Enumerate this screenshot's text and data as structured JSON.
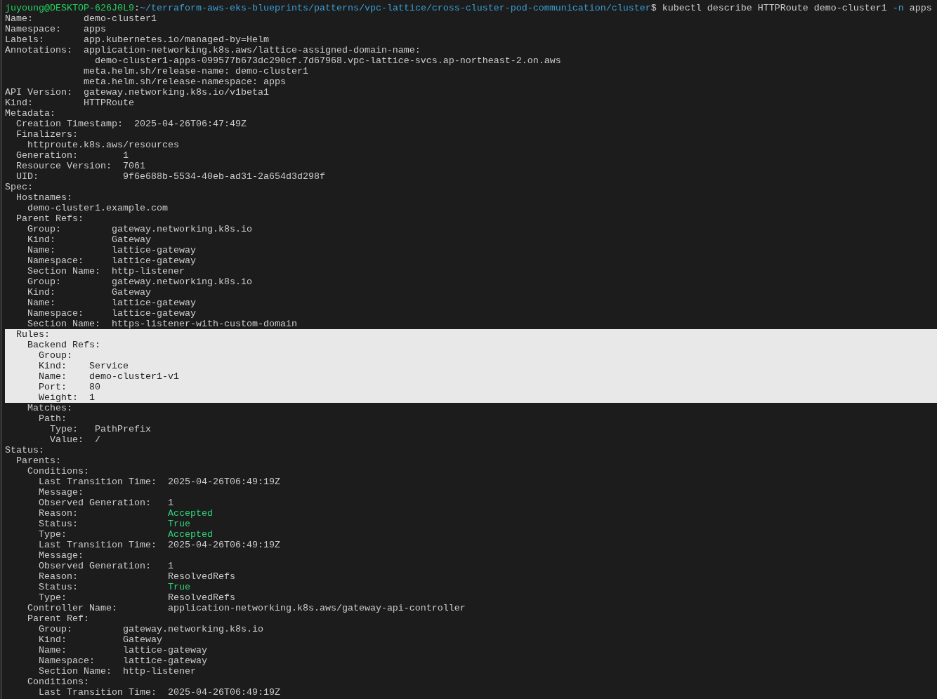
{
  "lines": [
    {
      "selected": false,
      "parts": [
        {
          "text": "juyoung@DESKTOP-626J0L9",
          "kind": "host"
        },
        {
          "text": ":",
          "kind": "plain"
        },
        {
          "text": "~/terraform-aws-eks-blueprints/patterns/vpc-lattice/cross-cluster-pod-communication/cluster",
          "kind": "path"
        },
        {
          "text": "$ kubectl describe HTTPRoute demo-cluster1 ",
          "kind": "plain"
        },
        {
          "text": "-n",
          "kind": "flag"
        },
        {
          "text": " apps",
          "kind": "plain"
        }
      ]
    },
    {
      "selected": false,
      "text": "Name:         demo-cluster1"
    },
    {
      "selected": false,
      "text": "Namespace:    apps"
    },
    {
      "selected": false,
      "text": "Labels:       app.kubernetes.io/managed-by=Helm"
    },
    {
      "selected": false,
      "text": "Annotations:  application-networking.k8s.aws/lattice-assigned-domain-name:"
    },
    {
      "selected": false,
      "text": "                demo-cluster1-apps-099577b673dc290cf.7d67968.vpc-lattice-svcs.ap-northeast-2.on.aws"
    },
    {
      "selected": false,
      "text": "              meta.helm.sh/release-name: demo-cluster1"
    },
    {
      "selected": false,
      "text": "              meta.helm.sh/release-namespace: apps"
    },
    {
      "selected": false,
      "text": "API Version:  gateway.networking.k8s.io/v1beta1"
    },
    {
      "selected": false,
      "text": "Kind:         HTTPRoute"
    },
    {
      "selected": false,
      "text": "Metadata:"
    },
    {
      "selected": false,
      "text": "  Creation Timestamp:  2025-04-26T06:47:49Z"
    },
    {
      "selected": false,
      "text": "  Finalizers:"
    },
    {
      "selected": false,
      "text": "    httproute.k8s.aws/resources"
    },
    {
      "selected": false,
      "text": "  Generation:        1"
    },
    {
      "selected": false,
      "text": "  Resource Version:  7061"
    },
    {
      "selected": false,
      "text": "  UID:               9f6e688b-5534-40eb-ad31-2a654d3d298f"
    },
    {
      "selected": false,
      "text": "Spec:"
    },
    {
      "selected": false,
      "text": "  Hostnames:"
    },
    {
      "selected": false,
      "text": "    demo-cluster1.example.com"
    },
    {
      "selected": false,
      "text": "  Parent Refs:"
    },
    {
      "selected": false,
      "text": "    Group:         gateway.networking.k8s.io"
    },
    {
      "selected": false,
      "text": "    Kind:          Gateway"
    },
    {
      "selected": false,
      "text": "    Name:          lattice-gateway"
    },
    {
      "selected": false,
      "text": "    Namespace:     lattice-gateway"
    },
    {
      "selected": false,
      "text": "    Section Name:  http-listener"
    },
    {
      "selected": false,
      "text": "    Group:         gateway.networking.k8s.io"
    },
    {
      "selected": false,
      "text": "    Kind:          Gateway"
    },
    {
      "selected": false,
      "text": "    Name:          lattice-gateway"
    },
    {
      "selected": false,
      "text": "    Namespace:     lattice-gateway"
    },
    {
      "selected": false,
      "text": "    Section Name:  https-listener-with-custom-domain"
    },
    {
      "selected": true,
      "text": "  Rules:"
    },
    {
      "selected": true,
      "text": "    Backend Refs:"
    },
    {
      "selected": true,
      "text": "      Group:"
    },
    {
      "selected": true,
      "text": "      Kind:    Service"
    },
    {
      "selected": true,
      "text": "      Name:    demo-cluster1-v1"
    },
    {
      "selected": true,
      "text": "      Port:    80"
    },
    {
      "selected": true,
      "text": "      Weight:  1"
    },
    {
      "selected": false,
      "text": "    Matches:"
    },
    {
      "selected": false,
      "text": "      Path:"
    },
    {
      "selected": false,
      "text": "        Type:   PathPrefix"
    },
    {
      "selected": false,
      "text": "        Value:  /"
    },
    {
      "selected": false,
      "text": "Status:"
    },
    {
      "selected": false,
      "text": "  Parents:"
    },
    {
      "selected": false,
      "text": "    Conditions:"
    },
    {
      "selected": false,
      "text": "      Last Transition Time:  2025-04-26T06:49:19Z"
    },
    {
      "selected": false,
      "text": "      Message:"
    },
    {
      "selected": false,
      "text": "      Observed Generation:   1"
    },
    {
      "selected": false,
      "parts": [
        {
          "text": "      Reason:                ",
          "kind": "plain"
        },
        {
          "text": "Accepted",
          "kind": "ok"
        }
      ]
    },
    {
      "selected": false,
      "parts": [
        {
          "text": "      Status:                ",
          "kind": "plain"
        },
        {
          "text": "True",
          "kind": "ok"
        }
      ]
    },
    {
      "selected": false,
      "parts": [
        {
          "text": "      Type:                  ",
          "kind": "plain"
        },
        {
          "text": "Accepted",
          "kind": "ok"
        }
      ]
    },
    {
      "selected": false,
      "text": "      Last Transition Time:  2025-04-26T06:49:19Z"
    },
    {
      "selected": false,
      "text": "      Message:"
    },
    {
      "selected": false,
      "text": "      Observed Generation:   1"
    },
    {
      "selected": false,
      "text": "      Reason:                ResolvedRefs"
    },
    {
      "selected": false,
      "parts": [
        {
          "text": "      Status:                ",
          "kind": "plain"
        },
        {
          "text": "True",
          "kind": "ok"
        }
      ]
    },
    {
      "selected": false,
      "text": "      Type:                  ResolvedRefs"
    },
    {
      "selected": false,
      "text": "    Controller Name:         application-networking.k8s.aws/gateway-api-controller"
    },
    {
      "selected": false,
      "text": "    Parent Ref:"
    },
    {
      "selected": false,
      "text": "      Group:         gateway.networking.k8s.io"
    },
    {
      "selected": false,
      "text": "      Kind:          Gateway"
    },
    {
      "selected": false,
      "text": "      Name:          lattice-gateway"
    },
    {
      "selected": false,
      "text": "      Namespace:     lattice-gateway"
    },
    {
      "selected": false,
      "text": "      Section Name:  http-listener"
    },
    {
      "selected": false,
      "text": "    Conditions:"
    },
    {
      "selected": false,
      "text": "      Last Transition Time:  2025-04-26T06:49:19Z"
    }
  ]
}
